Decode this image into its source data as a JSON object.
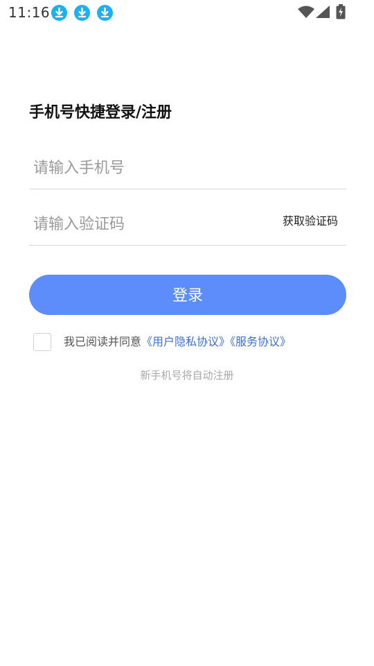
{
  "status_bar": {
    "time": "11:16",
    "notification_icons": [
      "download-icon",
      "download-icon",
      "download-icon"
    ],
    "right_icons": [
      "wifi-icon",
      "cell-signal-icon",
      "battery-charging-icon"
    ]
  },
  "login": {
    "title": "手机号快捷登录/注册",
    "phone_placeholder": "请输入手机号",
    "phone_value": "",
    "code_placeholder": "请输入验证码",
    "code_value": "",
    "get_code_label": "获取验证码",
    "login_label": "登录",
    "agreement_prefix": "我已阅读并同意",
    "privacy_link": "《用户隐私协议》",
    "service_link": "《服务协议》",
    "agreement_checked": false,
    "hint": "新手机号将自动注册"
  },
  "colors": {
    "accent": "#5c8dfb",
    "link": "#3b6fd8",
    "download_badge": "#1ab0f5"
  }
}
